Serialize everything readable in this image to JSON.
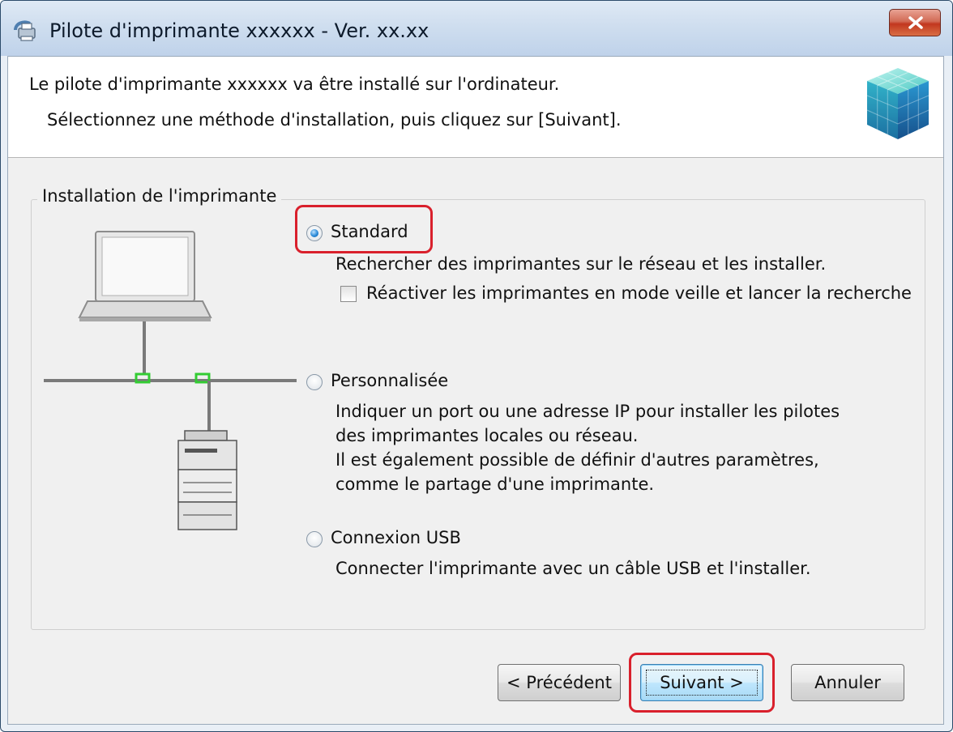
{
  "window": {
    "title": "Pilote d'imprimante xxxxxx - Ver. xx.xx",
    "close_icon": "close-icon",
    "app_icon": "printer-driver-icon"
  },
  "header": {
    "line1": "Le pilote d'imprimante xxxxxx va être installé sur l'ordinateur.",
    "line2": "Sélectionnez une méthode d'installation, puis cliquez sur [Suivant].",
    "icon": "installer-cube-icon"
  },
  "group": {
    "title": "Installation de l'imprimante",
    "illustration": "laptop-network-printer-illustration"
  },
  "options": [
    {
      "label": "Standard",
      "description": "Rechercher des imprimantes sur le réseau et les installer.",
      "checkbox_label": "Réactiver les imprimantes en mode veille et lancer la recherche",
      "checked": true
    },
    {
      "label": "Personnalisée",
      "description_lines": [
        "Indiquer un port ou une adresse IP pour installer les pilotes",
        "des imprimantes locales ou réseau.",
        "Il est également possible de définir d'autres paramètres,",
        "comme le partage d'une imprimante."
      ],
      "checked": false
    },
    {
      "label": "Connexion USB",
      "description": "Connecter l'imprimante avec un câble USB et l'installer.",
      "checked": false
    }
  ],
  "buttons": {
    "back": "< Précédent",
    "next": "Suivant >",
    "cancel": "Annuler"
  },
  "colors": {
    "highlight": "#d9202c",
    "selected_radio": "#2a8ad8"
  }
}
